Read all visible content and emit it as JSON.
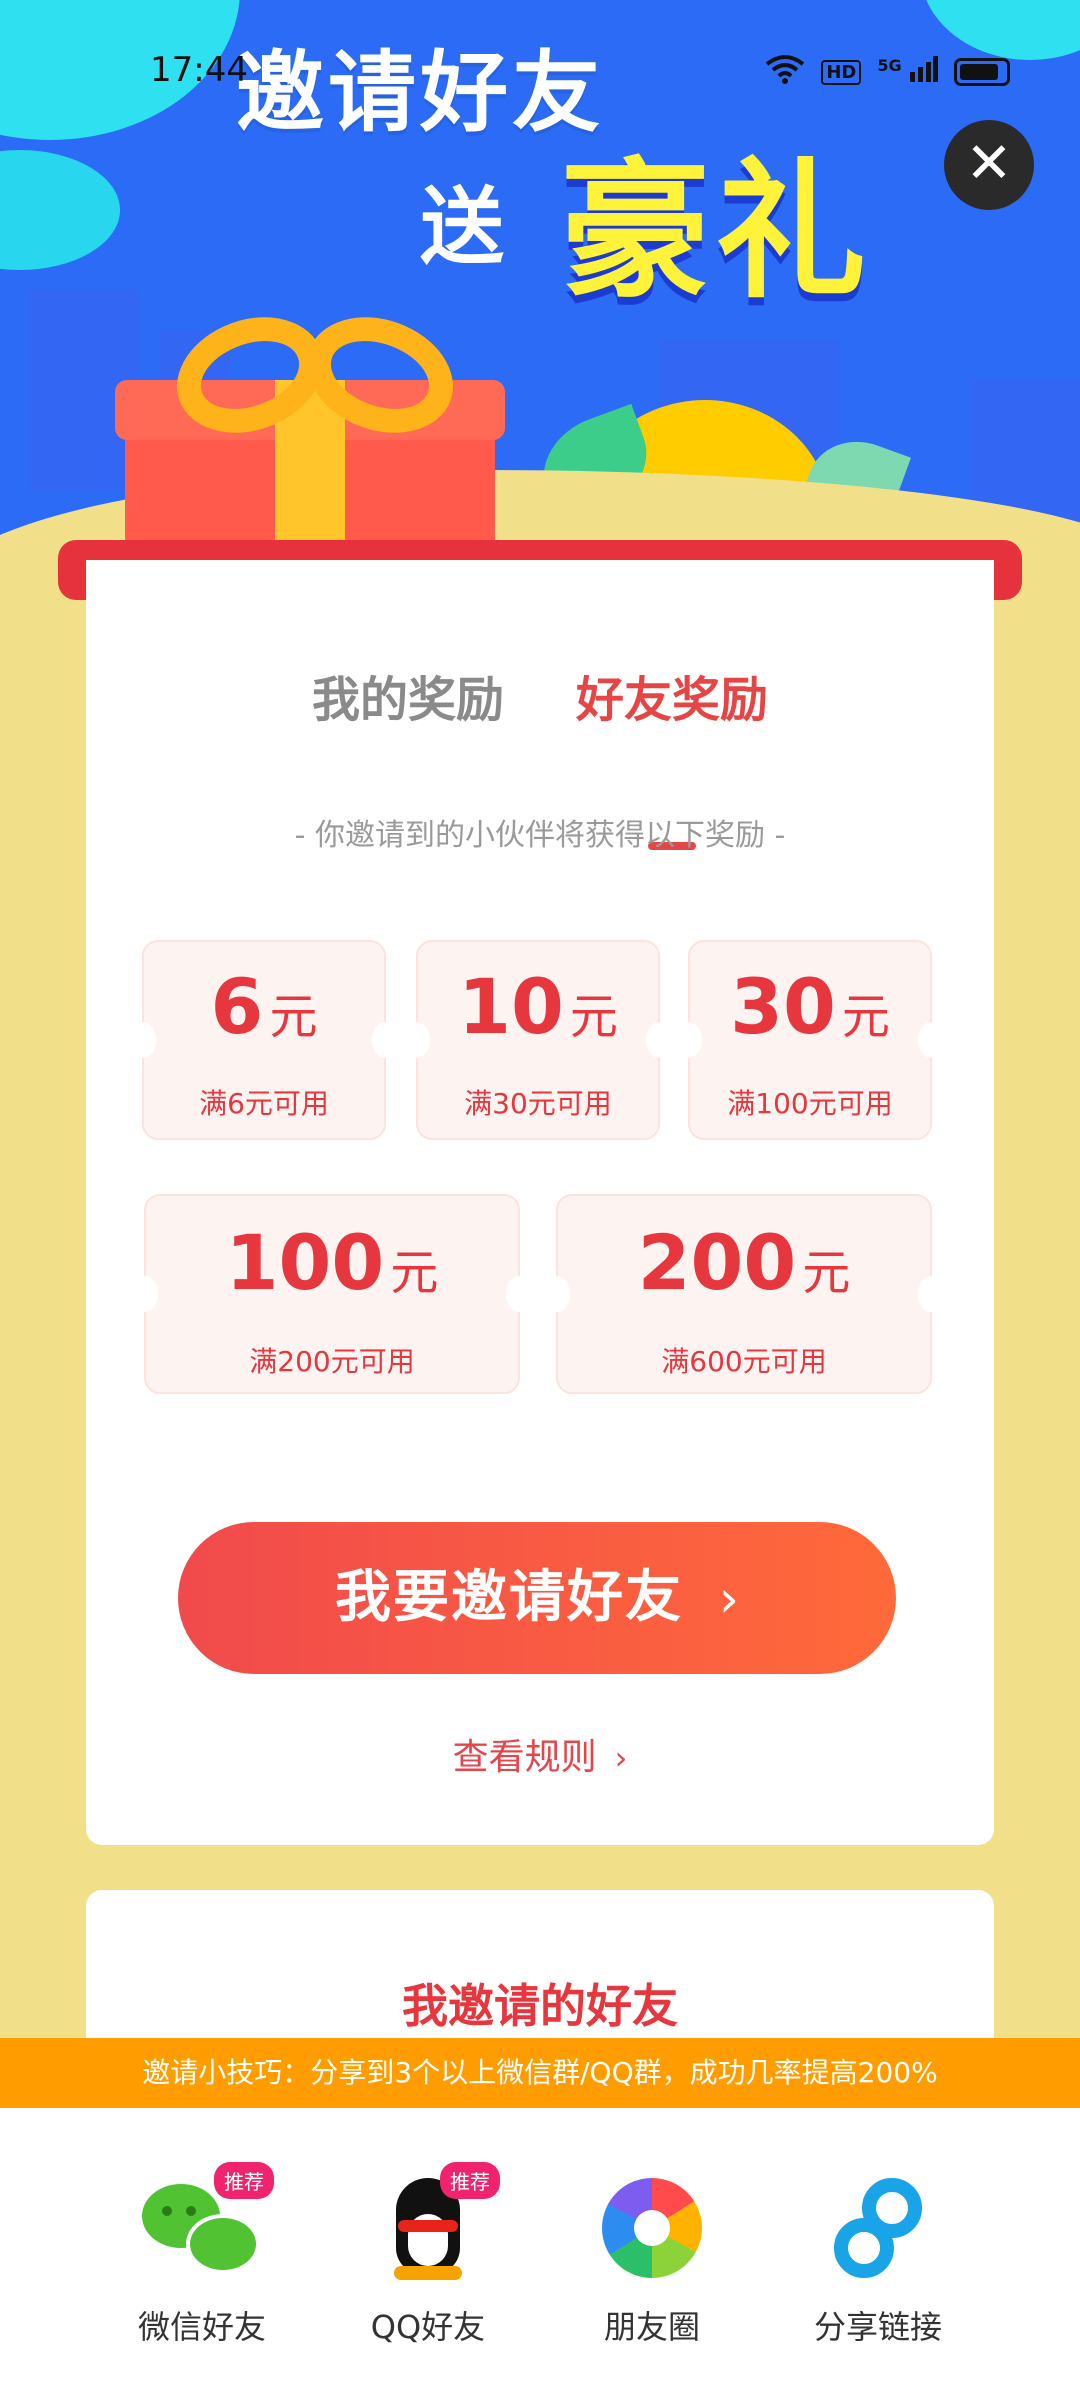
{
  "status_bar": {
    "time": "17:44",
    "hd": "HD",
    "network": "5G"
  },
  "hero": {
    "line1": "邀请好友",
    "line2_prefix": "送",
    "line2_highlight": "豪礼"
  },
  "close": {
    "symbol": "✕"
  },
  "tabs": [
    {
      "label": "我的奖励",
      "active": false
    },
    {
      "label": "好友奖励",
      "active": true
    }
  ],
  "subtitle": "- 你邀请到的小伙伴将获得以下奖励 -",
  "coupons": [
    {
      "amount": "6",
      "unit": "元",
      "condition": "满6元可用"
    },
    {
      "amount": "10",
      "unit": "元",
      "condition": "满30元可用"
    },
    {
      "amount": "30",
      "unit": "元",
      "condition": "满100元可用"
    },
    {
      "amount": "100",
      "unit": "元",
      "condition": "满200元可用"
    },
    {
      "amount": "200",
      "unit": "元",
      "condition": "满600元可用"
    }
  ],
  "cta": {
    "label": "我要邀请好友",
    "chevron": "›"
  },
  "rules": {
    "label": "查看规则",
    "chevron": "›"
  },
  "invited_section": {
    "title": "我邀请的好友"
  },
  "tip": "邀请小技巧：分享到3个以上微信群/QQ群，成功几率提高200%",
  "share": [
    {
      "name": "微信好友",
      "icon": "wechat-icon",
      "badge": "推荐"
    },
    {
      "name": "QQ好友",
      "icon": "qq-icon",
      "badge": "推荐"
    },
    {
      "name": "朋友圈",
      "icon": "moments-icon",
      "badge": ""
    },
    {
      "name": "分享链接",
      "icon": "link-icon",
      "badge": ""
    }
  ],
  "colors": {
    "primary_red": "#e6363e",
    "hero_blue": "#2b6bf5",
    "page_bg": "#f2df8a",
    "tip_orange": "#ff9d00",
    "badge_pink": "#f0236e"
  }
}
